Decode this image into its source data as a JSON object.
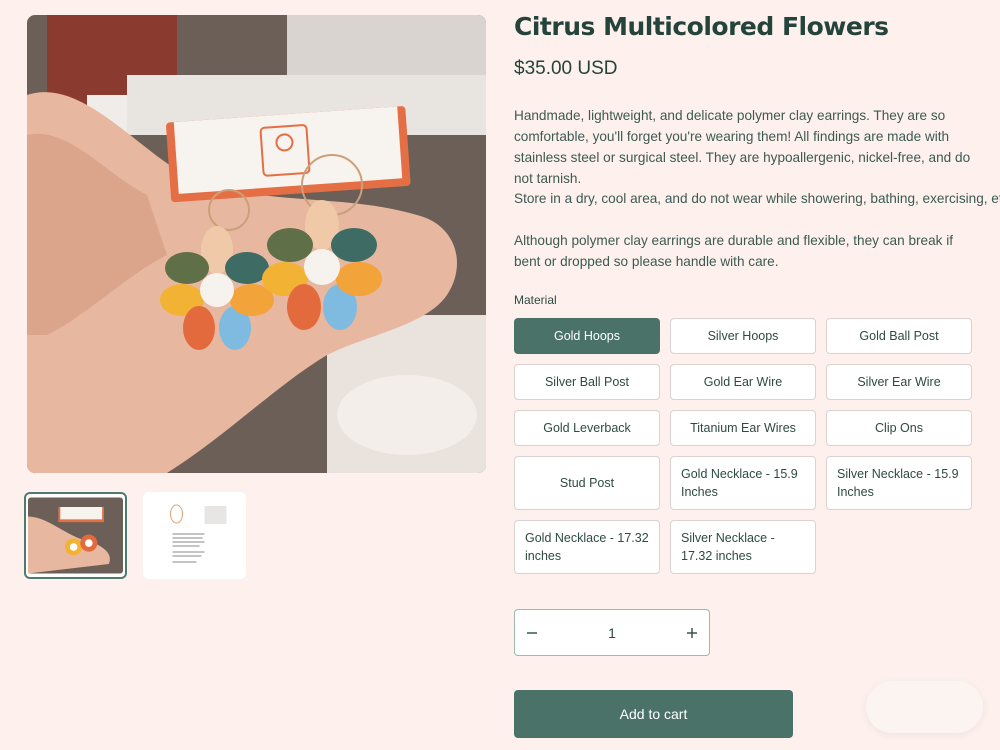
{
  "product": {
    "title": "Citrus Multicolored Flowers",
    "price": "$35.00 USD",
    "description": [
      "Handmade, lightweight, and delicate polymer clay earrings. They are so comfortable, you'll forget you're wearing them! All findings are made with stainless steel or surgical steel. They are hypoallergenic, nickel-free, and do not tarnish.",
      "Store in a dry, cool area, and do not wear while showering, bathing, exercising, etc.",
      "Although polymer clay earrings are durable and flexible, they can break if bent or dropped so please handle with care."
    ]
  },
  "gallery": {
    "card_brand": "Clay & CARIDAD",
    "card_url": "@clayandcaridad | www.clayandcaridad.com"
  },
  "material": {
    "label": "Material",
    "options": [
      "Gold Hoops",
      "Silver Hoops",
      "Gold Ball Post",
      "Silver Ball Post",
      "Gold Ear Wire",
      "Silver Ear Wire",
      "Gold Leverback",
      "Titanium Ear Wires",
      "Clip Ons",
      "Stud Post",
      "Gold Necklace - 15.9 Inches",
      "Silver Necklace - 15.9 Inches",
      "Gold Necklace - 17.32 inches",
      "Silver Necklace - 17.32 inches"
    ],
    "selected": "Gold Hoops"
  },
  "quantity": {
    "minus": "−",
    "value": "1",
    "plus": "+"
  },
  "cart": {
    "add_label": "Add to cart"
  },
  "colors": {
    "background": "#fdf0ed",
    "accent": "#4a7268",
    "title": "#24433b"
  }
}
